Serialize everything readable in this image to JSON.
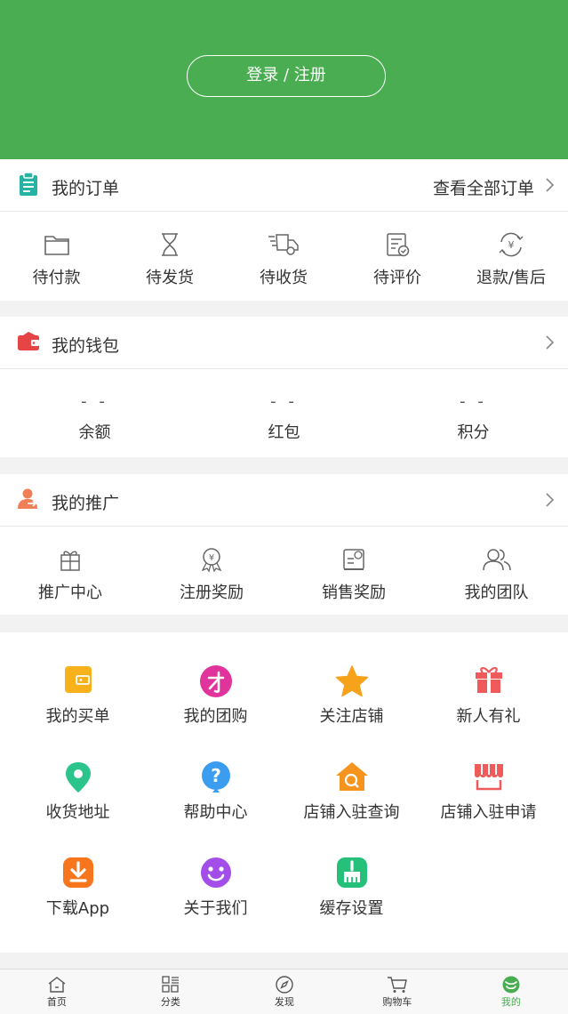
{
  "header": {
    "login_label": "登录 / 注册"
  },
  "orders": {
    "title": "我的订单",
    "view_all": "查看全部订单",
    "items": [
      {
        "label": "待付款",
        "icon": "folder-icon"
      },
      {
        "label": "待发货",
        "icon": "hourglass-icon"
      },
      {
        "label": "待收货",
        "icon": "delivery-truck-icon"
      },
      {
        "label": "待评价",
        "icon": "review-doc-icon"
      },
      {
        "label": "退款/售后",
        "icon": "refund-icon"
      }
    ]
  },
  "wallet": {
    "title": "我的钱包",
    "items": [
      {
        "value": "- -",
        "label": "余额"
      },
      {
        "value": "- -",
        "label": "红包"
      },
      {
        "value": "- -",
        "label": "积分"
      }
    ]
  },
  "promotion": {
    "title": "我的推广",
    "items": [
      {
        "label": "推广中心",
        "icon": "gift-box-icon"
      },
      {
        "label": "注册奖励",
        "icon": "award-medal-icon"
      },
      {
        "label": "销售奖励",
        "icon": "sales-reward-icon"
      },
      {
        "label": "我的团队",
        "icon": "team-icon"
      }
    ]
  },
  "services": {
    "items": [
      {
        "label": "我的买单",
        "icon": "wallet-card-icon",
        "color": "#f7b21b"
      },
      {
        "label": "我的团购",
        "icon": "group-buy-icon",
        "color": "#e0339b"
      },
      {
        "label": "关注店铺",
        "icon": "star-icon",
        "color": "#f7a21b"
      },
      {
        "label": "新人有礼",
        "icon": "gift-icon",
        "color": "#ef5a5a"
      },
      {
        "label": "收货地址",
        "icon": "location-pin-icon",
        "color": "#2bc48a"
      },
      {
        "label": "帮助中心",
        "icon": "help-question-icon",
        "color": "#3a9df0"
      },
      {
        "label": "店铺入驻查询",
        "icon": "store-search-icon",
        "color": "#f7941d"
      },
      {
        "label": "店铺入驻申请",
        "icon": "store-awning-icon",
        "color": "#ef5a5a"
      },
      {
        "label": "下载App",
        "icon": "download-icon",
        "color": "#f7751d"
      },
      {
        "label": "关于我们",
        "icon": "smiley-icon",
        "color": "#a34ee8"
      },
      {
        "label": "缓存设置",
        "icon": "broom-icon",
        "color": "#25c07a"
      }
    ]
  },
  "tabbar": {
    "items": [
      {
        "label": "首页",
        "icon": "home-icon"
      },
      {
        "label": "分类",
        "icon": "category-grid-icon"
      },
      {
        "label": "发现",
        "icon": "compass-icon"
      },
      {
        "label": "购物车",
        "icon": "cart-icon"
      },
      {
        "label": "我的",
        "icon": "profile-smile-icon"
      }
    ],
    "active_color": "#4aad52"
  },
  "colors": {
    "brand": "#4aad52",
    "text": "#333333"
  }
}
